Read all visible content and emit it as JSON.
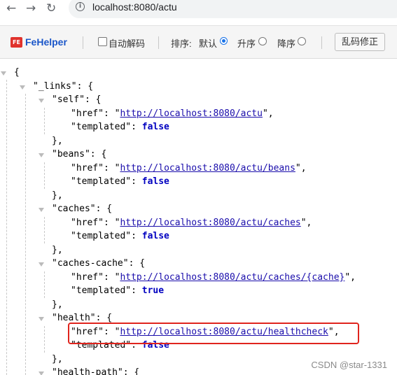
{
  "browser": {
    "back_glyph": "←",
    "forward_glyph": "→",
    "reload_glyph": "↻",
    "info_glyph": "i",
    "url": "localhost:8080/actu"
  },
  "toolbar": {
    "logo_glyph": "FE",
    "name": "FeHelper",
    "auto_decode_label": "自动解码",
    "sort_label": "排序:",
    "sort_default_label": "默认",
    "sort_asc_label": "升序",
    "sort_desc_label": "降序",
    "sort_selected": "默认",
    "fix_button_label": "乱码修正"
  },
  "json_lines": [
    {
      "segs": [
        {
          "c": "str",
          "t": "{"
        }
      ]
    },
    {
      "segs": [
        {
          "c": "key",
          "t": "\"_links\""
        },
        {
          "c": "str",
          "t": ": {"
        }
      ]
    },
    {
      "segs": [
        {
          "c": "key",
          "t": "\"self\""
        },
        {
          "c": "str",
          "t": ": {"
        }
      ]
    },
    {
      "segs": [
        {
          "c": "key",
          "t": "\"href\""
        },
        {
          "c": "str",
          "t": ": \""
        },
        {
          "c": "link",
          "t": "http://localhost:8080/actu"
        },
        {
          "c": "str",
          "t": "\","
        }
      ]
    },
    {
      "segs": [
        {
          "c": "key",
          "t": "\"templated\""
        },
        {
          "c": "str",
          "t": ": "
        },
        {
          "c": "kw",
          "t": "false"
        }
      ]
    },
    {
      "segs": [
        {
          "c": "str",
          "t": "},"
        }
      ]
    },
    {
      "segs": [
        {
          "c": "key",
          "t": "\"beans\""
        },
        {
          "c": "str",
          "t": ": {"
        }
      ]
    },
    {
      "segs": [
        {
          "c": "key",
          "t": "\"href\""
        },
        {
          "c": "str",
          "t": ": \""
        },
        {
          "c": "link",
          "t": "http://localhost:8080/actu/beans"
        },
        {
          "c": "str",
          "t": "\","
        }
      ]
    },
    {
      "segs": [
        {
          "c": "key",
          "t": "\"templated\""
        },
        {
          "c": "str",
          "t": ": "
        },
        {
          "c": "kw",
          "t": "false"
        }
      ]
    },
    {
      "segs": [
        {
          "c": "str",
          "t": "},"
        }
      ]
    },
    {
      "segs": [
        {
          "c": "key",
          "t": "\"caches\""
        },
        {
          "c": "str",
          "t": ": {"
        }
      ]
    },
    {
      "segs": [
        {
          "c": "key",
          "t": "\"href\""
        },
        {
          "c": "str",
          "t": ": \""
        },
        {
          "c": "link",
          "t": "http://localhost:8080/actu/caches"
        },
        {
          "c": "str",
          "t": "\","
        }
      ]
    },
    {
      "segs": [
        {
          "c": "key",
          "t": "\"templated\""
        },
        {
          "c": "str",
          "t": ": "
        },
        {
          "c": "kw",
          "t": "false"
        }
      ]
    },
    {
      "segs": [
        {
          "c": "str",
          "t": "},"
        }
      ]
    },
    {
      "segs": [
        {
          "c": "key",
          "t": "\"caches-cache\""
        },
        {
          "c": "str",
          "t": ": {"
        }
      ]
    },
    {
      "segs": [
        {
          "c": "key",
          "t": "\"href\""
        },
        {
          "c": "str",
          "t": ": \""
        },
        {
          "c": "link",
          "t": "http://localhost:8080/actu/caches/{cache}"
        },
        {
          "c": "str",
          "t": "\","
        }
      ]
    },
    {
      "segs": [
        {
          "c": "key",
          "t": "\"templated\""
        },
        {
          "c": "str",
          "t": ": "
        },
        {
          "c": "kw",
          "t": "true"
        }
      ]
    },
    {
      "segs": [
        {
          "c": "str",
          "t": "},"
        }
      ]
    },
    {
      "segs": [
        {
          "c": "key",
          "t": "\"health\""
        },
        {
          "c": "str",
          "t": ": {"
        }
      ]
    },
    {
      "segs": [
        {
          "c": "key",
          "t": "\"href\""
        },
        {
          "c": "str",
          "t": ": \""
        },
        {
          "c": "link",
          "t": "http://localhost:8080/actu/healthcheck"
        },
        {
          "c": "str",
          "t": "\","
        }
      ]
    },
    {
      "segs": [
        {
          "c": "key",
          "t": "\"templated\""
        },
        {
          "c": "str",
          "t": ": "
        },
        {
          "c": "kw",
          "t": "false"
        }
      ]
    },
    {
      "segs": [
        {
          "c": "str",
          "t": "},"
        }
      ]
    },
    {
      "segs": [
        {
          "c": "key",
          "t": "\"health-path\""
        },
        {
          "c": "str",
          "t": ": {"
        }
      ]
    }
  ],
  "watermark": "CSDN @star-1331",
  "colors": {
    "link": "#1a0dab",
    "keyword": "#0000c0",
    "highlight_box": "#e0241d",
    "brand": "#1a56c9"
  }
}
